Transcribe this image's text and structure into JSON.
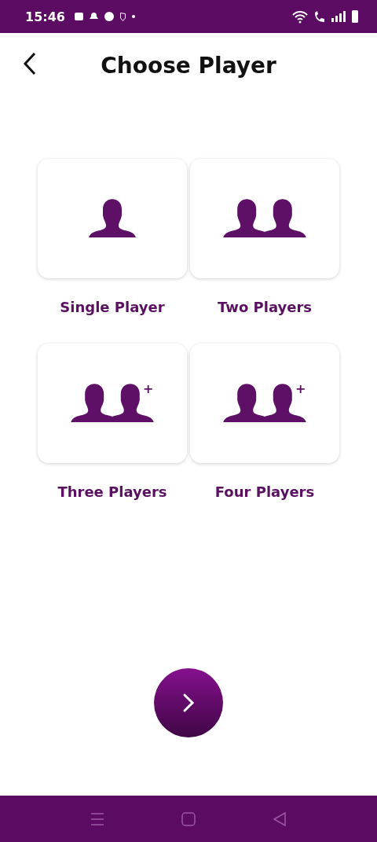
{
  "status_bar": {
    "time": "15:46"
  },
  "header": {
    "title": "Choose Player"
  },
  "options": [
    {
      "label": "Single Player",
      "kind": "single"
    },
    {
      "label": "Two Players",
      "kind": "double"
    },
    {
      "label": "Three Players",
      "kind": "double_plus",
      "badge": "+"
    },
    {
      "label": "Four Players",
      "kind": "double_plus",
      "badge": "+"
    }
  ]
}
